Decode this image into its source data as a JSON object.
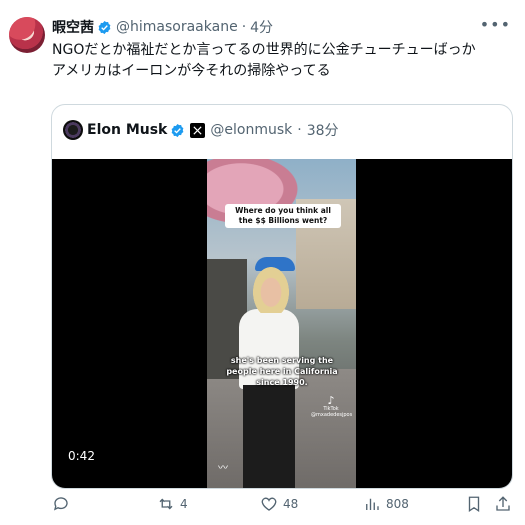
{
  "author": {
    "display_name": "暇空茜",
    "handle": "@himasoraakane",
    "time": "4分",
    "verified": true
  },
  "tweet": {
    "lines": [
      "NGOだとか福祉だとか言ってるの世界的に公金チューチューばっか",
      "アメリカはイーロンが今それの掃除やってる"
    ]
  },
  "quote": {
    "display_name": "Elon Musk",
    "handle": "@elonmusk",
    "time": "38分",
    "video": {
      "top_caption": "Where do you think all the $$ Billions went?",
      "subtitle": "she's been serving the people here in California since 1990.",
      "watermark_app": "TikTok",
      "watermark_user": "@mxadedesjpos",
      "duration": "0:42"
    }
  },
  "actions": {
    "reply": {
      "icon": "reply-icon",
      "count": ""
    },
    "repost": {
      "icon": "repost-icon",
      "count": "4"
    },
    "like": {
      "icon": "like-icon",
      "count": "48"
    },
    "views": {
      "icon": "views-icon",
      "count": "808"
    },
    "bookmark": {
      "icon": "bookmark-icon"
    },
    "share": {
      "icon": "share-icon"
    }
  },
  "colors": {
    "verified": "#1d9bf0",
    "secondary_text": "#536471",
    "border": "#cfd9de"
  }
}
